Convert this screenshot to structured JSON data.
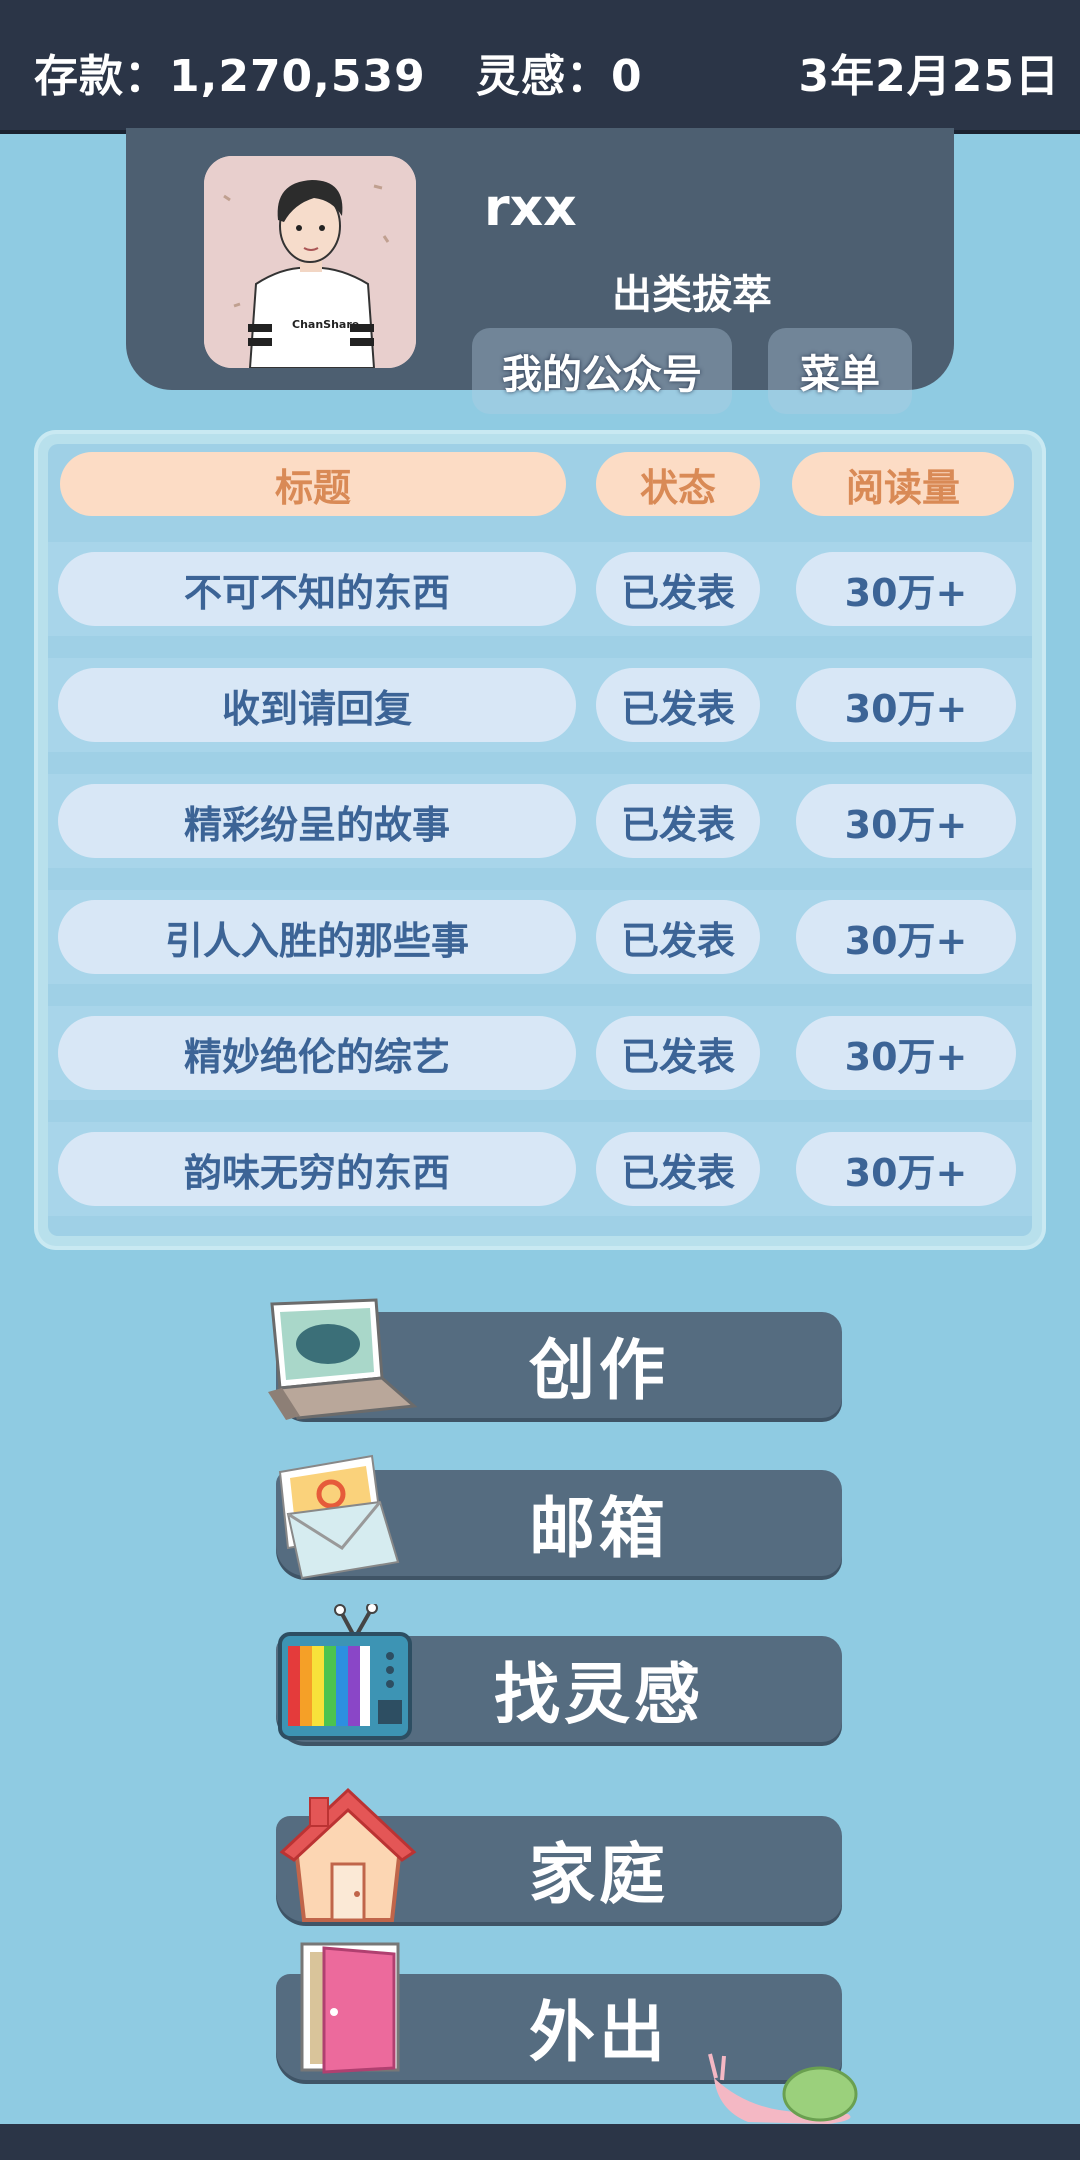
{
  "status_bar": {
    "savings": "存款：1,270,539",
    "inspiration": "灵感：0",
    "date": "3年2月25日"
  },
  "profile": {
    "username": "rxx",
    "title": "出类拔萃",
    "official_account_label": "我的公众号",
    "menu_label": "菜单"
  },
  "table": {
    "headers": [
      "标题",
      "状态",
      "阅读量"
    ],
    "rows": [
      {
        "title": "不可不知的东西",
        "status": "已发表",
        "reads": "30万+"
      },
      {
        "title": "收到请回复",
        "status": "已发表",
        "reads": "30万+"
      },
      {
        "title": "精彩纷呈的故事",
        "status": "已发表",
        "reads": "30万+"
      },
      {
        "title": "引人入胜的那些事",
        "status": "已发表",
        "reads": "30万+"
      },
      {
        "title": "精妙绝伦的综艺",
        "status": "已发表",
        "reads": "30万+"
      },
      {
        "title": "韵味无穷的东西",
        "status": "已发表",
        "reads": "30万+"
      }
    ]
  },
  "actions": [
    {
      "label": "创作",
      "icon": "laptop-icon"
    },
    {
      "label": "邮箱",
      "icon": "envelope-icon"
    },
    {
      "label": "找灵感",
      "icon": "tv-icon"
    },
    {
      "label": "家庭",
      "icon": "house-icon"
    },
    {
      "label": "外出",
      "icon": "door-icon"
    }
  ],
  "colors": {
    "background": "#8fcbe2",
    "top_bar": "#2b3547",
    "card": "#4d5f71",
    "button": "#556c80",
    "header_cell": "#fcdcc5",
    "header_text": "#d98a56",
    "row_cell": "#d8e7f6",
    "row_text": "#3c6496"
  }
}
